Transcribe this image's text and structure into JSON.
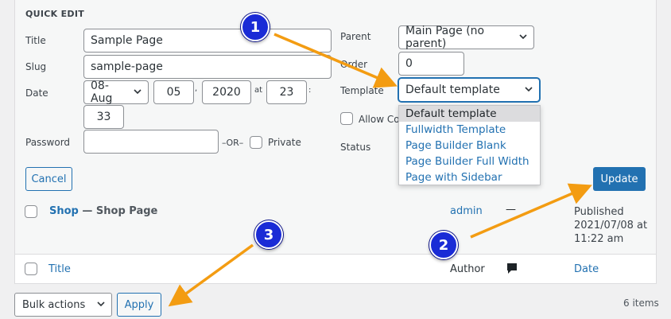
{
  "quick_edit": {
    "heading": "QUICK EDIT",
    "title_label": "Title",
    "title_value": "Sample Page",
    "slug_label": "Slug",
    "slug_value": "sample-page",
    "date_label": "Date",
    "date_month": "08-Aug",
    "date_day": "05",
    "date_sep_comma": ",",
    "date_year": "2020",
    "date_at": "at",
    "date_hour": "23",
    "date_colon": ":",
    "date_minute": "33",
    "password_label": "Password",
    "password_value": "",
    "or_text": "–OR–",
    "private_label": "Private",
    "parent_label": "Parent",
    "parent_value": "Main Page (no parent)",
    "order_label": "Order",
    "order_value": "0",
    "template_label": "Template",
    "template_value": "Default template",
    "template_options": [
      "Default template",
      "Fullwidth Template",
      "Page Builder Blank",
      "Page Builder Full Width",
      "Page with Sidebar"
    ],
    "allow_comments_label": "Allow Co",
    "status_label": "Status",
    "cancel_label": "Cancel",
    "update_label": "Update"
  },
  "rows": [
    {
      "title": "Shop",
      "suffix": "— Shop Page",
      "author": "admin",
      "comments": "—",
      "date_line1": "Published",
      "date_line2": "2021/07/08 at",
      "date_line3": "11:22 am"
    }
  ],
  "footer": {
    "title_col": "Title",
    "author_col": "Author",
    "date_col": "Date"
  },
  "bulk": {
    "select_value": "Bulk actions",
    "apply_label": "Apply",
    "items_count": "6 items"
  },
  "annotations": {
    "badge_1": "1",
    "badge_2": "2",
    "badge_3": "3",
    "badge_color": "#1a2bd6",
    "arrow_color": "#f39c12"
  }
}
